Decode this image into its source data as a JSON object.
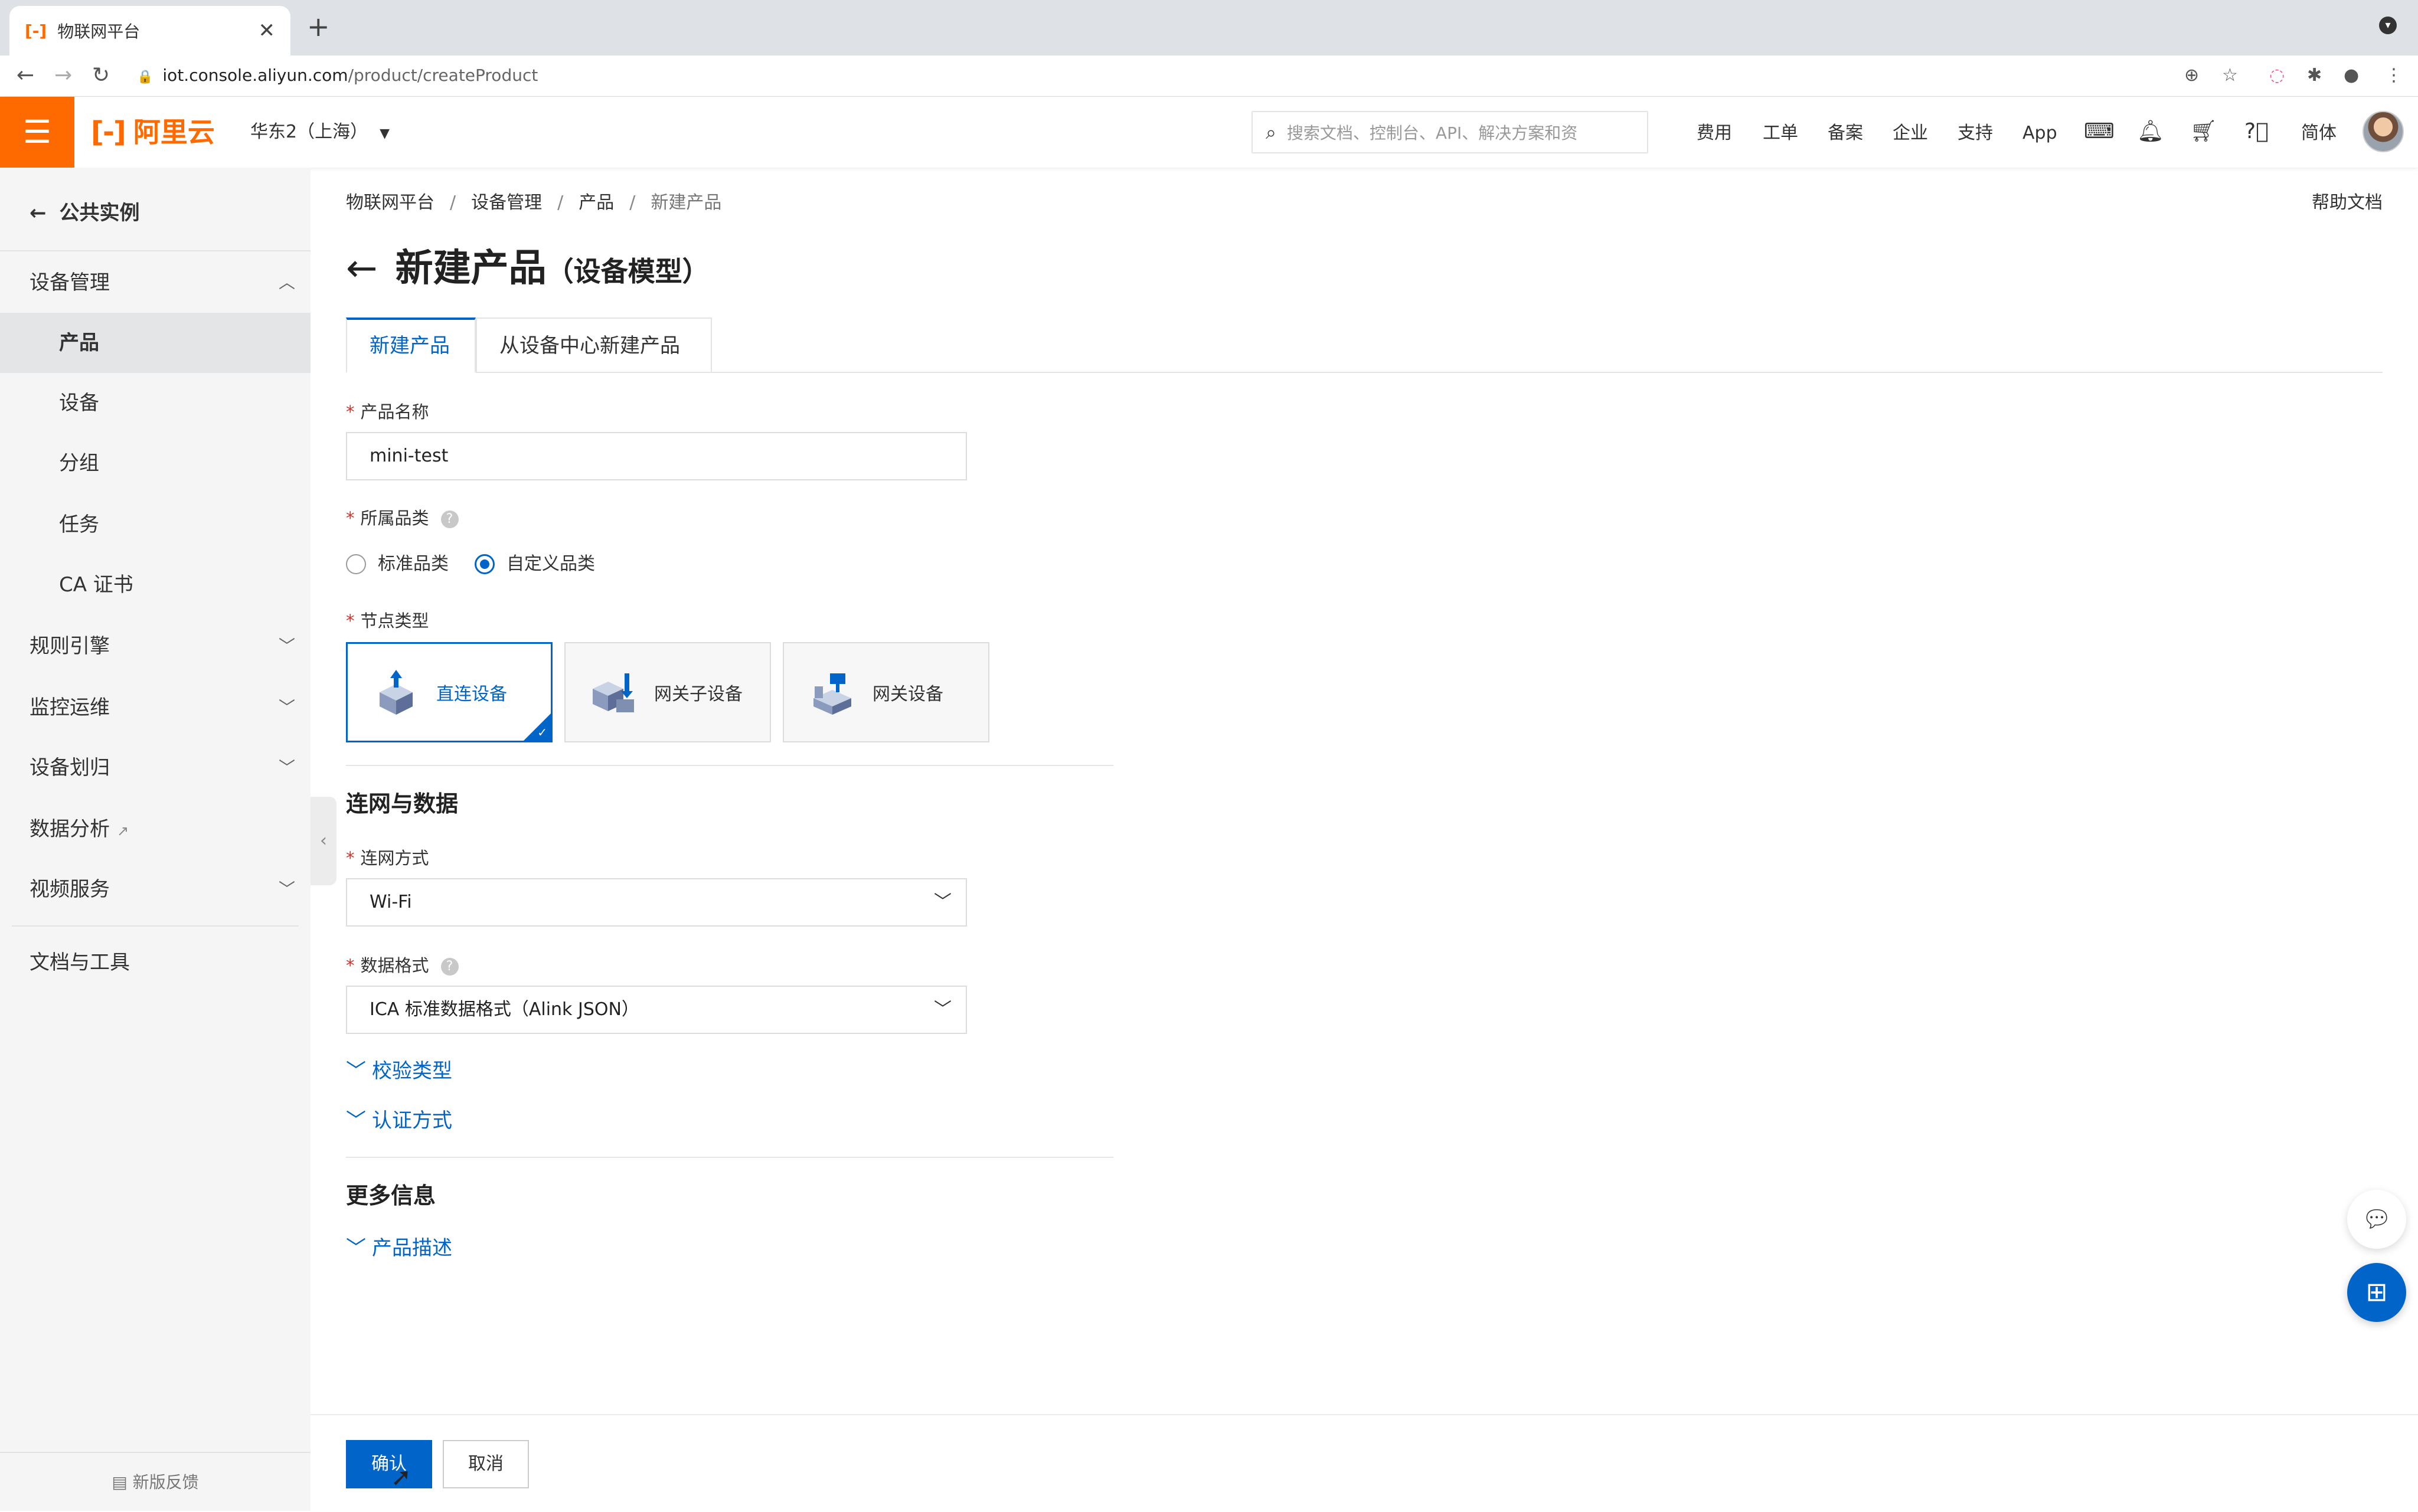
{
  "browser": {
    "tab_title": "物联网平台",
    "tab_favicon": "[-]",
    "url_host": "iot.console.aliyun.com",
    "url_path": "/product/createProduct"
  },
  "topbar": {
    "brand": "阿里云",
    "brand_mark": "[-]",
    "region": "华东2（上海）",
    "search_placeholder": "搜索文档、控制台、API、解决方案和资",
    "nav": [
      "费用",
      "工单",
      "备案",
      "企业",
      "支持",
      "App"
    ],
    "lang": "简体"
  },
  "sidebar": {
    "back_label": "公共实例",
    "group_device": "设备管理",
    "items": [
      "产品",
      "设备",
      "分组",
      "任务",
      "CA 证书"
    ],
    "groups_collapsed": [
      "规则引擎",
      "监控运维",
      "设备划归"
    ],
    "data_analysis": "数据分析",
    "video": "视频服务",
    "docs": "文档与工具",
    "feedback": "新版反馈"
  },
  "breadcrumb": [
    "物联网平台",
    "设备管理",
    "产品",
    "新建产品"
  ],
  "help": "帮助文档",
  "page": {
    "title": "新建产品",
    "subtitle": "（设备模型）",
    "tabs": [
      "新建产品",
      "从设备中心新建产品"
    ]
  },
  "form": {
    "product_name_label": "产品名称",
    "product_name_value": "mini-test",
    "category_label": "所属品类",
    "category_options": [
      "标准品类",
      "自定义品类"
    ],
    "category_selected": "自定义品类",
    "node_type_label": "节点类型",
    "node_types": [
      "直连设备",
      "网关子设备",
      "网关设备"
    ],
    "node_type_selected": "直连设备",
    "section_network": "连网与数据",
    "network_label": "连网方式",
    "network_value": "Wi-Fi",
    "data_format_label": "数据格式",
    "data_format_value": "ICA 标准数据格式（Alink JSON）",
    "verify_type": "校验类型",
    "auth_method": "认证方式",
    "section_more": "更多信息",
    "product_desc": "产品描述"
  },
  "actions": {
    "confirm": "确认",
    "cancel": "取消"
  },
  "colors": {
    "brand": "#ff6a00",
    "primary": "#0064c8",
    "required": "#d93026"
  }
}
